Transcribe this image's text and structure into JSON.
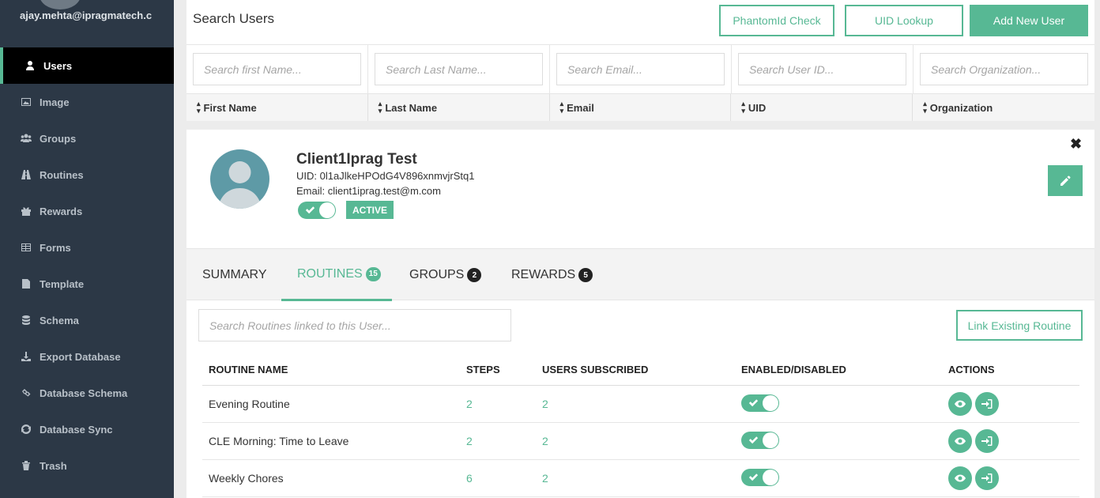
{
  "sidebar": {
    "user_email": "ajay.mehta@ipragmatech.c",
    "items": [
      {
        "label": "Users",
        "icon": "user-icon",
        "active": true
      },
      {
        "label": "Image",
        "icon": "image-icon"
      },
      {
        "label": "Groups",
        "icon": "users-icon"
      },
      {
        "label": "Routines",
        "icon": "road-icon"
      },
      {
        "label": "Rewards",
        "icon": "gift-icon"
      },
      {
        "label": "Forms",
        "icon": "table-icon"
      },
      {
        "label": "Template",
        "icon": "file-icon"
      },
      {
        "label": "Schema",
        "icon": "database-icon"
      },
      {
        "label": "Export Database",
        "icon": "download-icon"
      },
      {
        "label": "Database Schema",
        "icon": "link-icon"
      },
      {
        "label": "Database Sync",
        "icon": "refresh-icon"
      },
      {
        "label": "Trash",
        "icon": "trash-icon"
      }
    ]
  },
  "header": {
    "title": "Search Users",
    "buttons": {
      "phantom": "PhantomId Check",
      "uid_lookup": "UID Lookup",
      "add_user": "Add New User"
    }
  },
  "filters": {
    "first_name": "Search first Name...",
    "last_name": "Search Last Name...",
    "email": "Search Email...",
    "user_id": "Search User ID...",
    "organization": "Search Organization..."
  },
  "columns": [
    "First Name",
    "Last Name",
    "Email",
    "UID",
    "Organization"
  ],
  "user": {
    "name": "Client1Iprag Test",
    "uid": "UID: 0l1aJlkeHPOdG4V896xnmvjrStq1",
    "email": "Email: client1iprag.test@m.com",
    "status": "ACTIVE",
    "enabled": true
  },
  "tabs": {
    "summary": "SUMMARY",
    "routines": "ROUTINES",
    "routines_count": "15",
    "groups": "GROUPS",
    "groups_count": "2",
    "rewards": "REWARDS",
    "rewards_count": "5",
    "active": "routines"
  },
  "routines_panel": {
    "search_placeholder": "Search Routines linked to this User...",
    "link_button": "Link Existing Routine",
    "headers": {
      "name": "ROUTINE NAME",
      "steps": "STEPS",
      "users": "USERS SUBSCRIBED",
      "enabled": "ENABLED/DISABLED",
      "actions": "ACTIONS"
    },
    "rows": [
      {
        "name": "Evening Routine",
        "steps": "2",
        "users": "2",
        "enabled": true
      },
      {
        "name": "CLE Morning: Time to Leave",
        "steps": "2",
        "users": "2",
        "enabled": true
      },
      {
        "name": "Weekly Chores",
        "steps": "6",
        "users": "2",
        "enabled": true
      }
    ]
  },
  "colors": {
    "accent": "#57b894",
    "sidebar_bg": "#2c3846",
    "active_nav_bg": "#000000"
  }
}
